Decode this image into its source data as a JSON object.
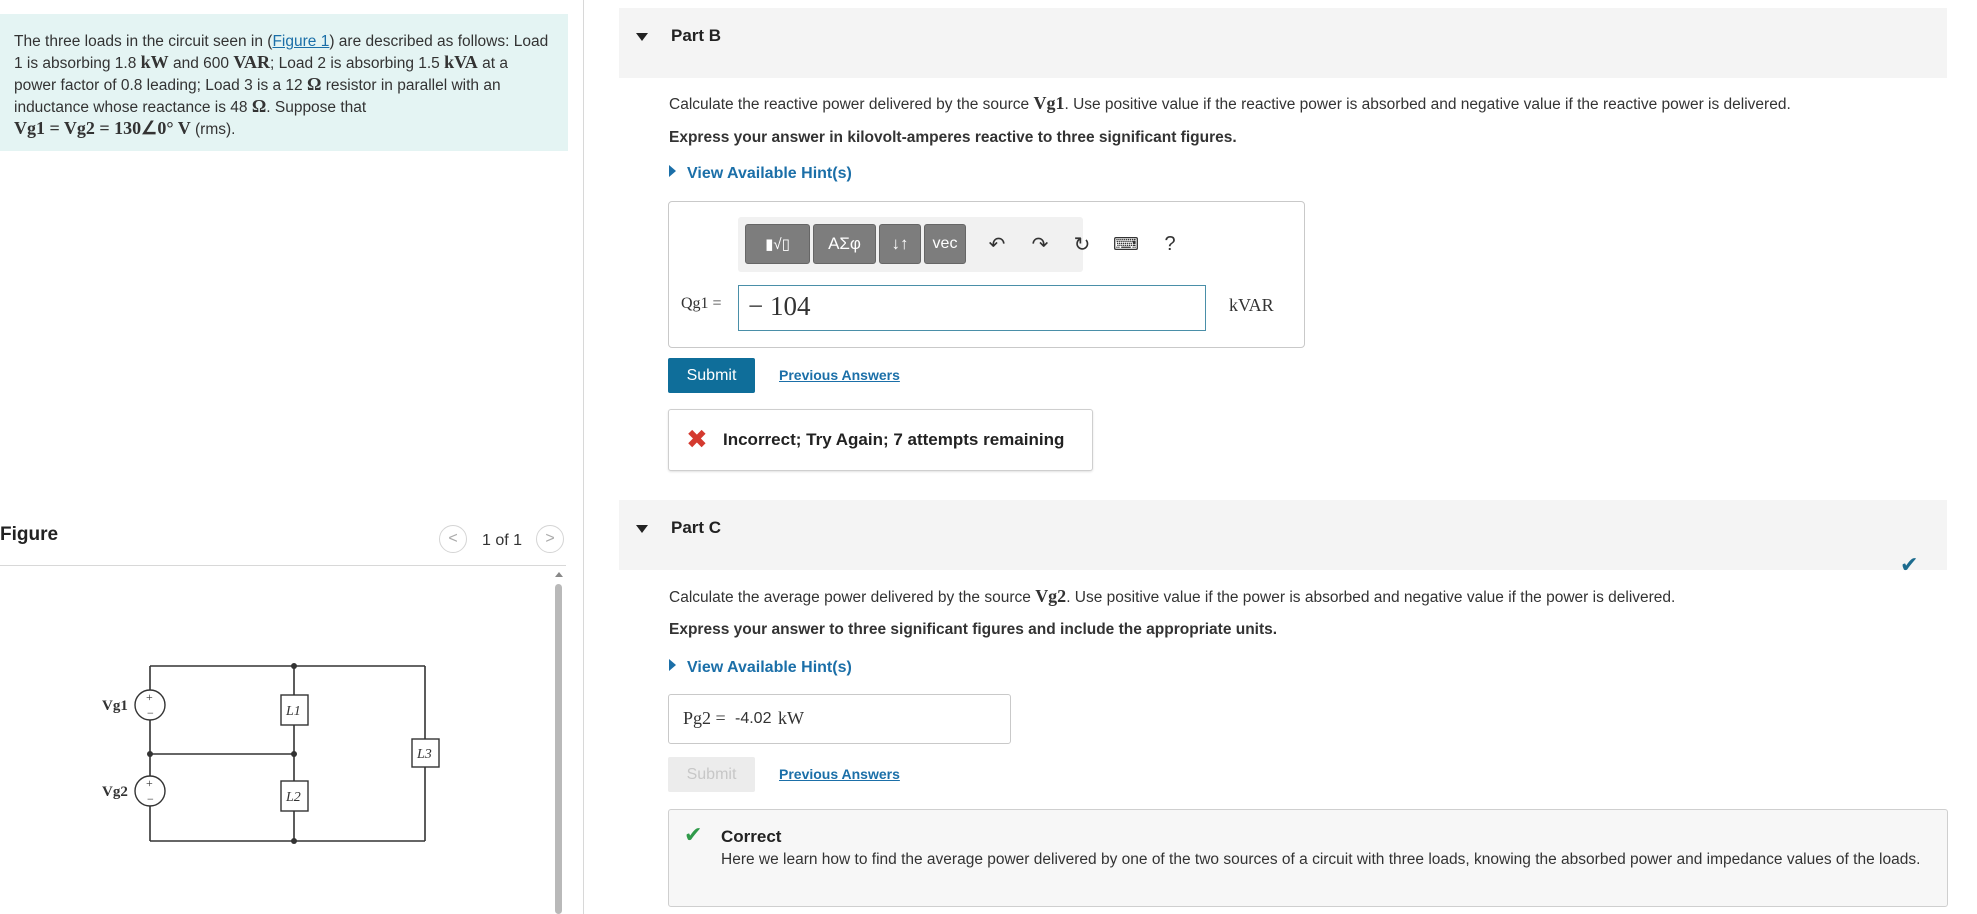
{
  "problem": {
    "text_1": "The three loads in the circuit seen in (",
    "figure_link": "Figure 1",
    "text_2": ") are described as follows: Load 1 is absorbing 1.8 ",
    "unit_kW": "kW",
    "text_3": " and 600 ",
    "unit_VAR": "VAR",
    "text_4": "; Load 2 is absorbing 1.5 ",
    "unit_kVA": "kVA",
    "text_5": " at a power factor of 0.8 leading; Load 3 is a 12 ",
    "ohm_1": "Ω",
    "text_6": " resistor in parallel with an inductance whose reactance is 48 ",
    "ohm_2": "Ω",
    "text_7": ". Suppose that",
    "formula": "Vg1 = Vg2 = 130∠0° V",
    "rms": " (rms)."
  },
  "figure": {
    "title": "Figure",
    "counter": "1 of 1",
    "prev_glyph": "<",
    "next_glyph": ">",
    "circuit_labels": {
      "vg1": "Vg1",
      "vg2": "Vg2",
      "l1": "L1",
      "l2": "L2",
      "l3": "L3"
    }
  },
  "part_b": {
    "label": "Part B",
    "instruction_pre": "Calculate the reactive power delivered by the source ",
    "instruction_sym": "Vg1",
    "instruction_post": ". Use positive value if the reactive power is absorbed and negative value if the reactive power is delivered.",
    "express": "Express your answer in kilovolt-amperes reactive to three significant figures.",
    "hint": "View Available Hint(s)",
    "toolbar": {
      "templates": "▮√▯",
      "greek": "ΑΣφ",
      "arrows": "↓↑",
      "vec": "vec",
      "undo": "↶",
      "redo": "↷",
      "reset": "↻",
      "keyboard": "⌨",
      "help": "?"
    },
    "input_label": "Qg1 =",
    "input_value": "− 104",
    "unit": "kVAR",
    "submit": "Submit",
    "previous_answers": "Previous Answers",
    "feedback_icon": "✖",
    "feedback": "Incorrect; Try Again; 7 attempts remaining"
  },
  "part_c": {
    "label": "Part C",
    "completed_icon": "✔",
    "instruction_pre": "Calculate the average power delivered by the source ",
    "instruction_sym": "Vg2",
    "instruction_post": ". Use positive value if the power is absorbed and negative value if the power is delivered.",
    "express": "Express your answer to three significant figures and include the appropriate units.",
    "hint": "View Available Hint(s)",
    "answer_label": "Pg2 =",
    "answer_value": "-4.02",
    "answer_unit": "kW",
    "submit": "Submit",
    "previous_answers": "Previous Answers",
    "feedback_icon": "✔",
    "feedback_title": "Correct",
    "feedback_body": "Here we learn how to find the average power delivered by one of the two sources of a circuit with three loads, knowing the absorbed power and impedance values of the loads."
  },
  "colors": {
    "problem_bg": "#e4f4f3",
    "link": "#1b6fa8",
    "submit": "#0f6e9a",
    "error": "#d43a2f",
    "success": "#2f9a4a"
  }
}
